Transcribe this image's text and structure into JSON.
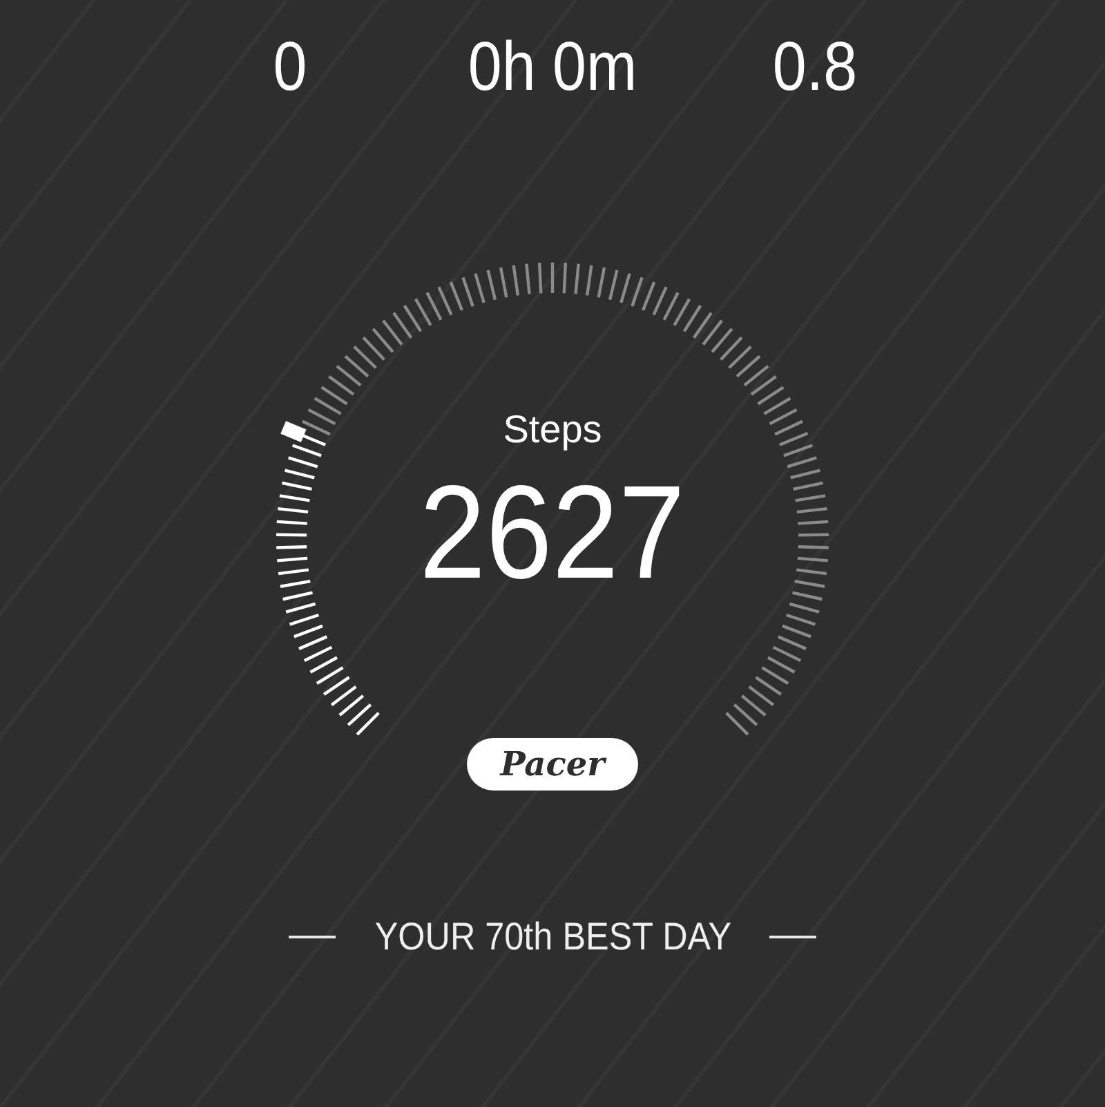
{
  "stats": [
    {
      "value": "0"
    },
    {
      "value": "0h 0m"
    },
    {
      "value": "0.8"
    }
  ],
  "steps": {
    "label": "Steps",
    "value": "2627"
  },
  "badge": {
    "text": "Pacer"
  },
  "rank": {
    "text": "YOUR 70th BEST DAY"
  }
}
